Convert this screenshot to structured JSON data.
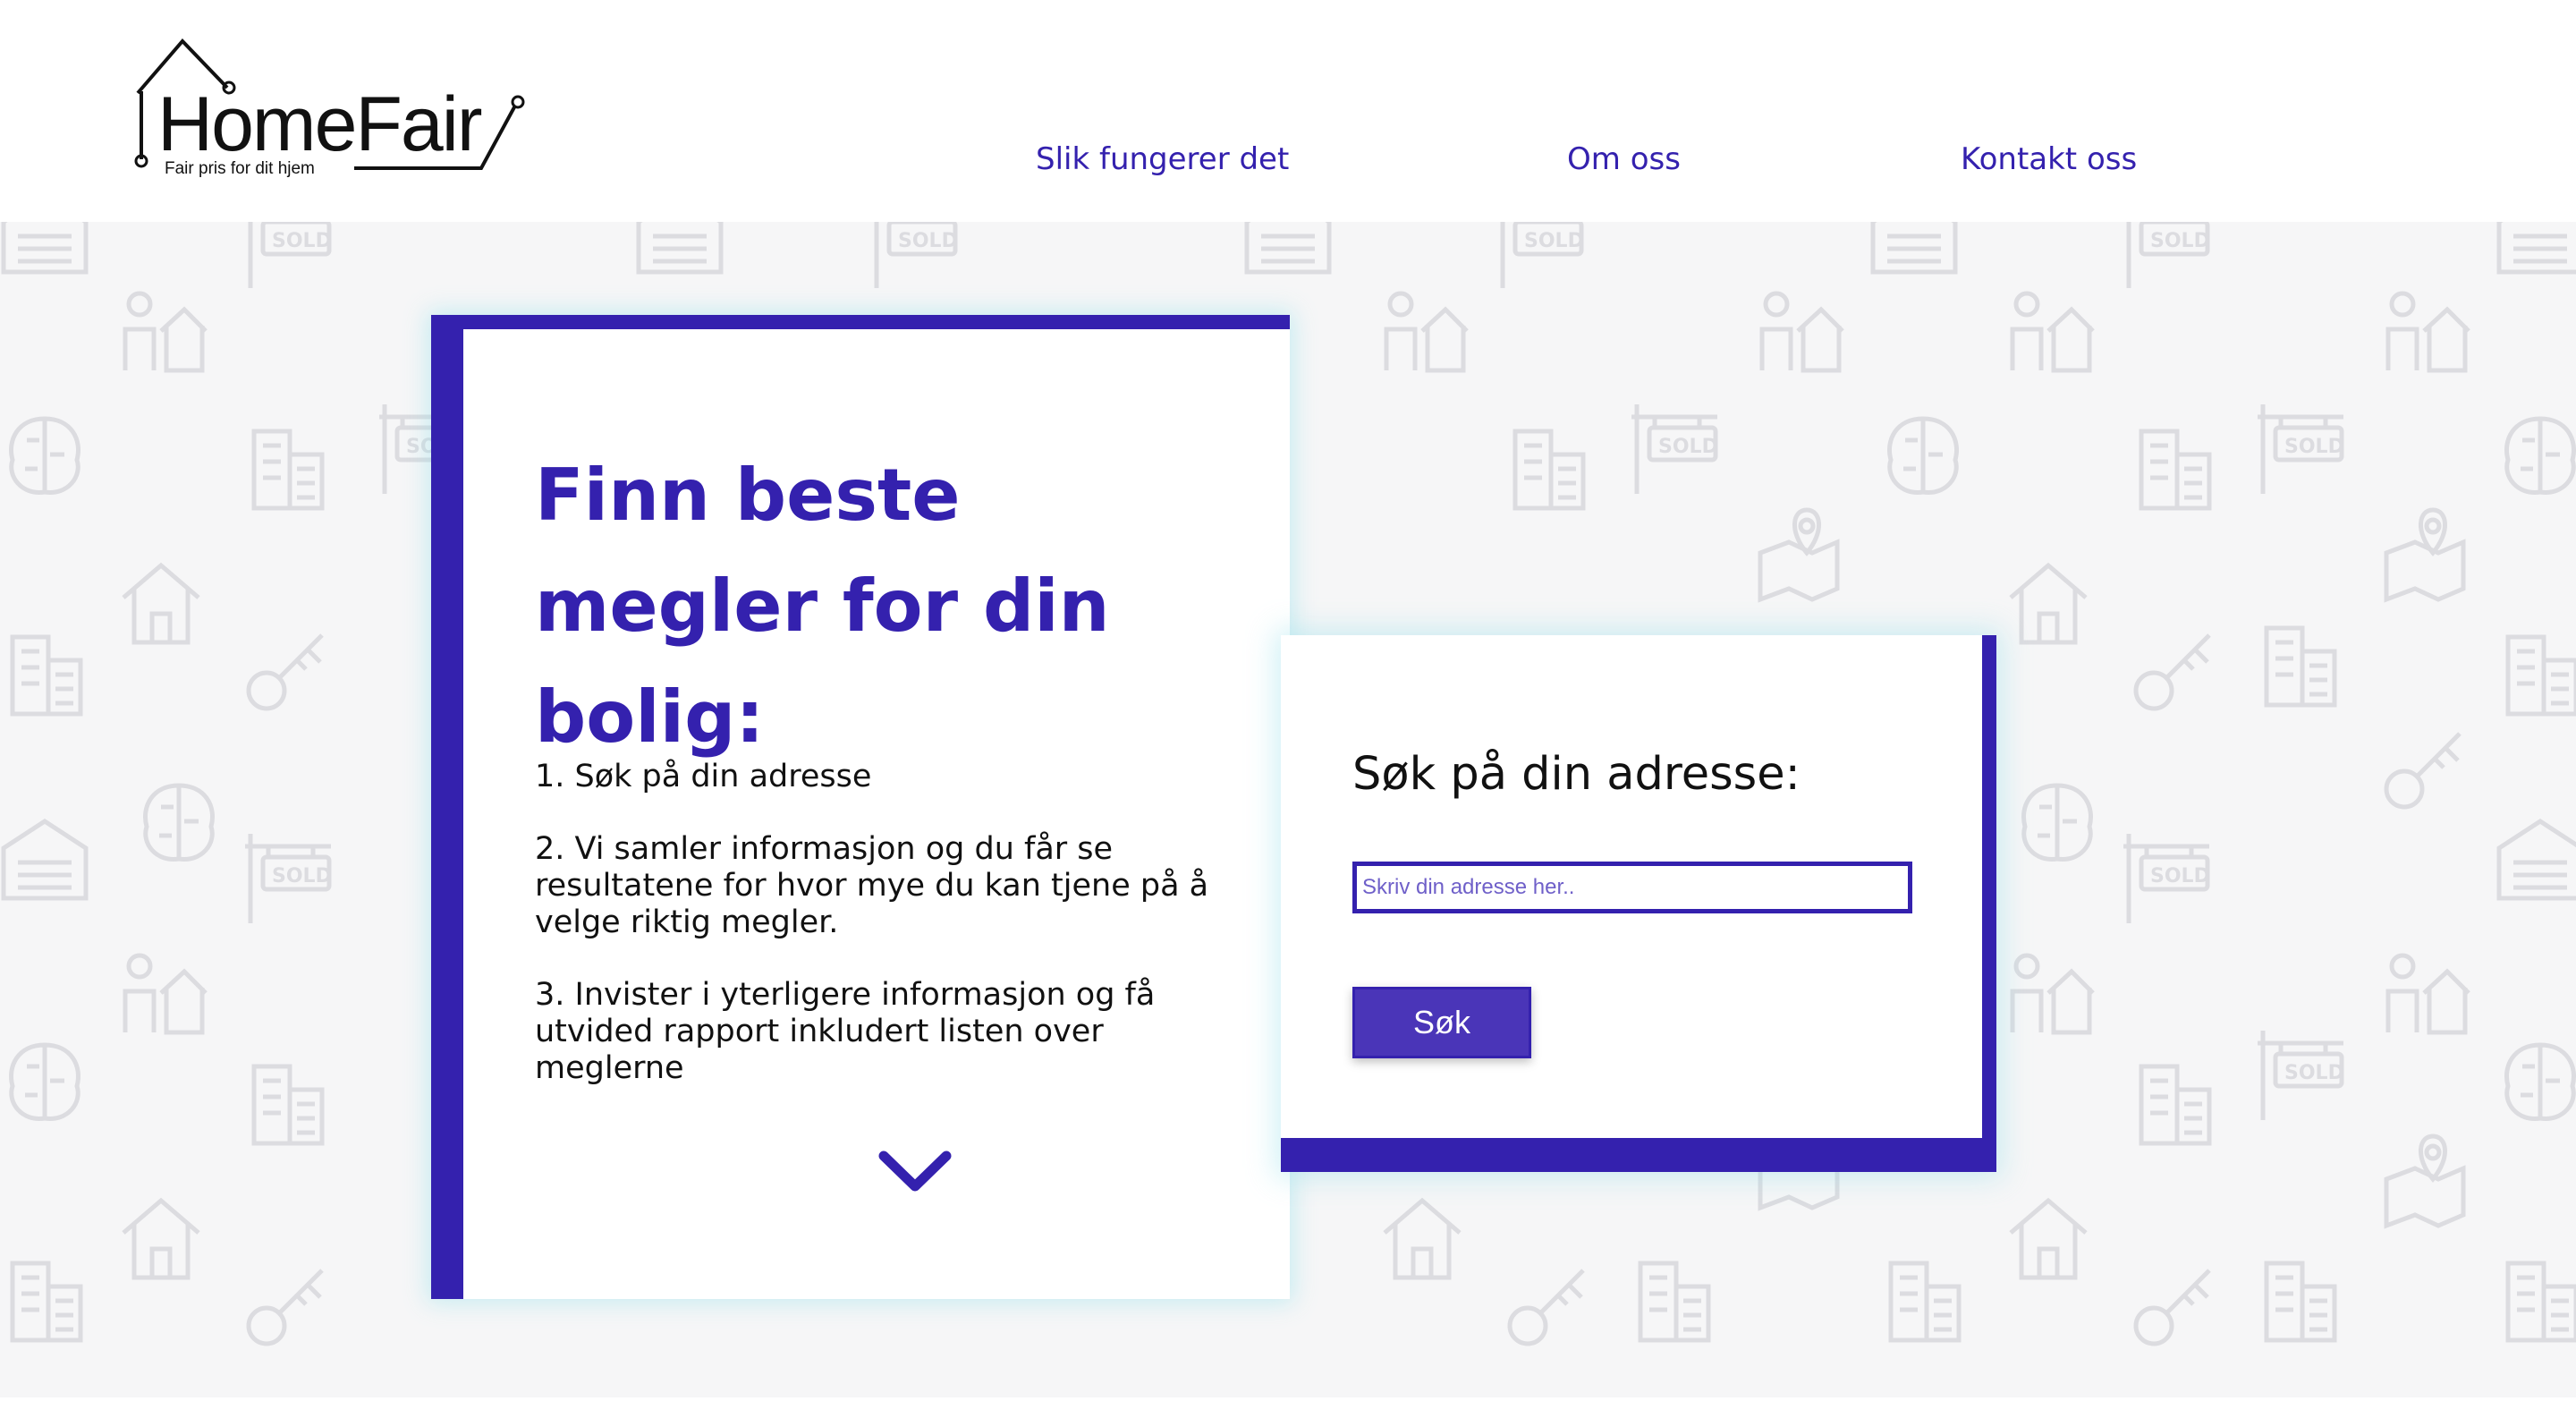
{
  "logo": {
    "wordmark": "HomeFair",
    "tagline": "Fair pris for dit hjem"
  },
  "nav": {
    "items": [
      {
        "label": "Slik fungerer det"
      },
      {
        "label": "Om oss"
      },
      {
        "label": "Kontakt oss"
      }
    ]
  },
  "intro": {
    "title": "Finn beste megler for din bolig:",
    "steps": [
      {
        "text": "1. Søk på din adresse"
      },
      {
        "text": "2. Vi samler informasjon og du får se resultatene for hvor mye du kan tjene på å velge riktig megler."
      },
      {
        "text": "3. Invister i yterligere informasjon og få utvided rapport inkludert listen over meglerne"
      }
    ],
    "scroll_icon": "chevron-down-icon"
  },
  "search": {
    "title": "Søk på din adresse:",
    "placeholder": "Skriv din adresse her..",
    "value": "",
    "button_label": "Søk"
  },
  "background": {
    "pattern_icons": [
      "house-icon",
      "sold-sign-icon",
      "key-icon",
      "building-icon",
      "brain-icon",
      "map-pin-icon",
      "person-house-icon",
      "garage-icon"
    ]
  },
  "colors": {
    "primary": "#3421ae",
    "pattern": "#dddde0",
    "background": "#f6f6f7",
    "glow": "#8ce1eb"
  }
}
